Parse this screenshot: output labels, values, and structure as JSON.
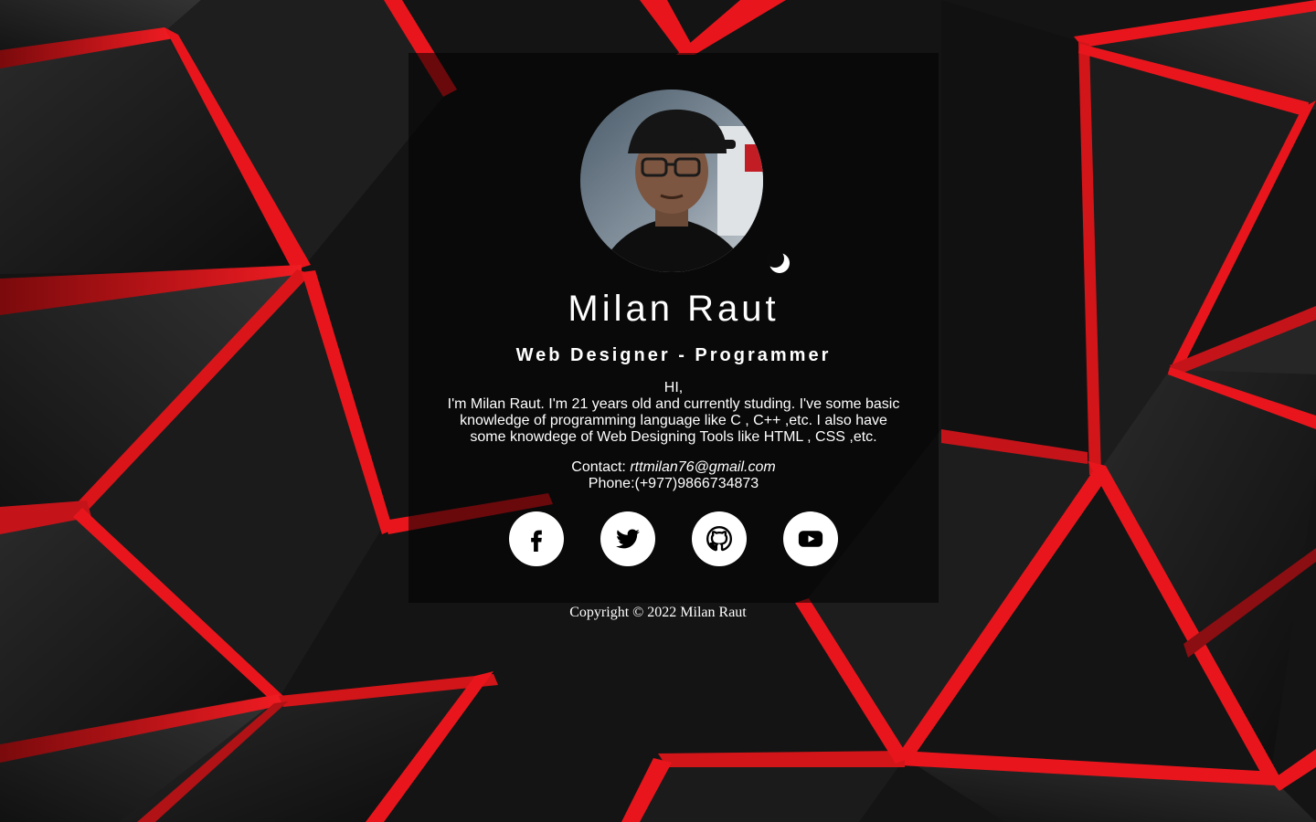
{
  "colors": {
    "background": "#151515",
    "accent": "#e8161c",
    "card_overlay": "rgba(0,0,0,0.55)",
    "text": "#ffffff",
    "button_bg": "#ffffff",
    "button_icon": "#000000"
  },
  "profile": {
    "name": "Milan Raut",
    "role": "Web Designer - Programmer",
    "greeting": "HI,",
    "bio": "I'm Milan Raut. I'm 21 years old and currently studing. I've some basic knowledge of programming language like C , C++ ,etc. I also have some knowdege of Web Designing Tools like HTML , CSS ,etc.",
    "contact_label": "Contact:",
    "email": "rttmilan76@gmail.com",
    "phone": "Phone:(+977)9866734873"
  },
  "theme_toggle": {
    "icon": "moon-icon"
  },
  "social": [
    {
      "icon": "facebook-icon"
    },
    {
      "icon": "twitter-icon"
    },
    {
      "icon": "github-icon"
    },
    {
      "icon": "youtube-icon"
    }
  ],
  "footer": {
    "copyright": "Copyright © 2022 Milan Raut"
  }
}
